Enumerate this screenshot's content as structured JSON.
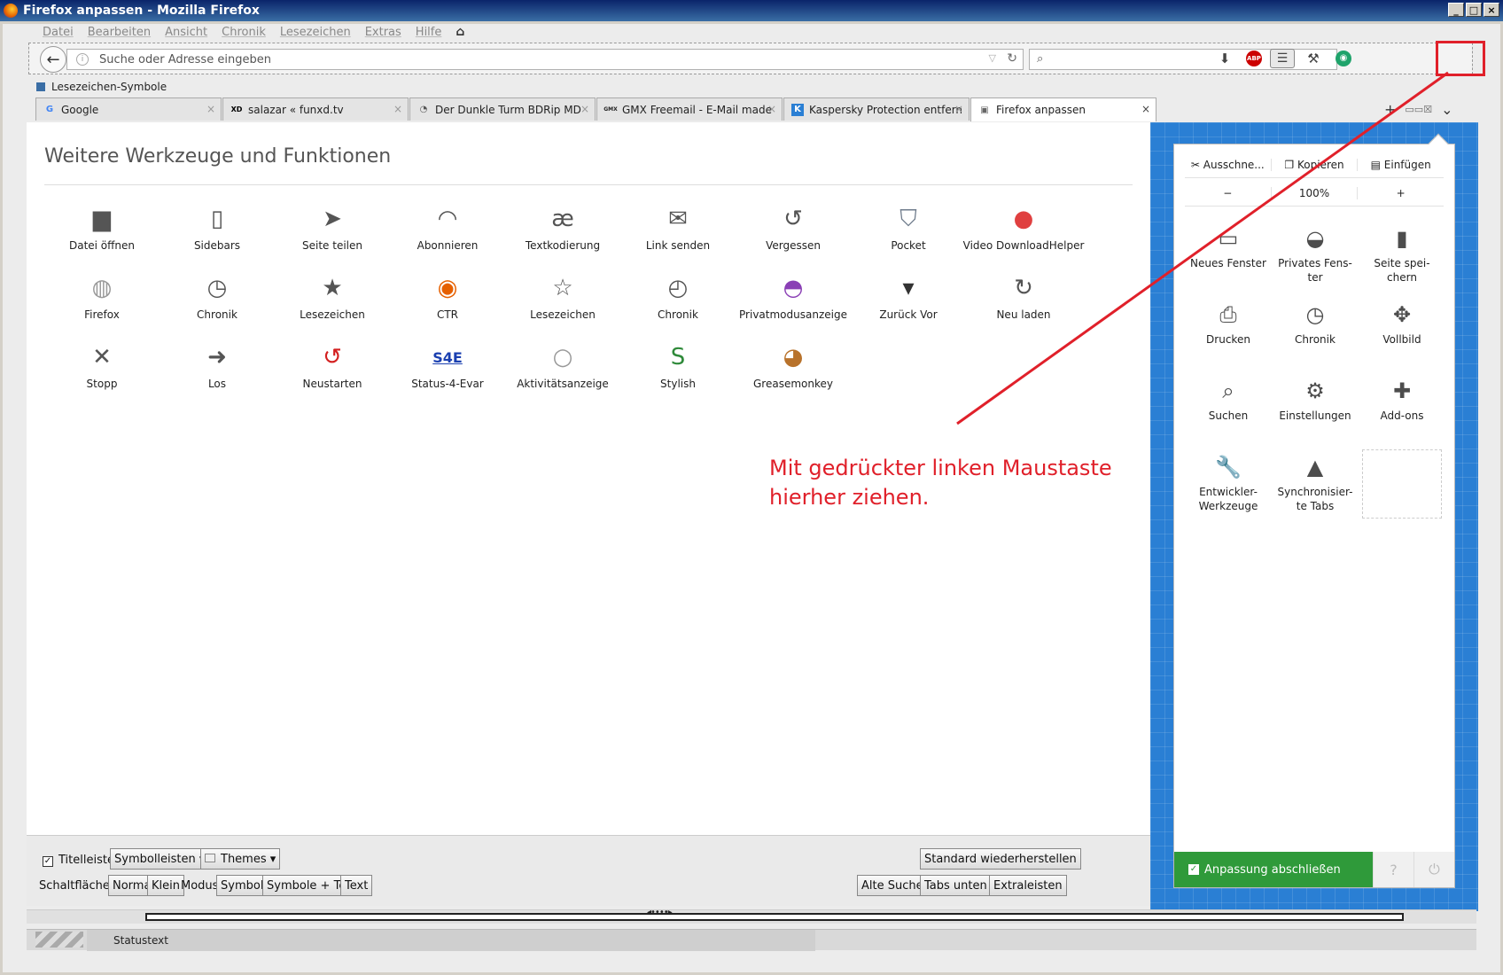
{
  "window": {
    "title": "Firefox anpassen - Mozilla Firefox",
    "controls": [
      "_",
      "□",
      "×"
    ]
  },
  "menu": [
    "Datei",
    "Bearbeiten",
    "Ansicht",
    "Chronik",
    "Lesezeichen",
    "Extras",
    "Hilfe"
  ],
  "urlbar": {
    "placeholder": "Suche oder Adresse eingeben"
  },
  "bookmarks": {
    "label": "Lesezeichen-Symbole"
  },
  "tabs": [
    {
      "title": "Google",
      "icon": "G"
    },
    {
      "title": "salazar « funxd.tv",
      "icon": "XD"
    },
    {
      "title": "Der Dunkle Turm BDRip MD",
      "icon": "◔"
    },
    {
      "title": "GMX Freemail - E-Mail made",
      "icon": "GMX"
    },
    {
      "title": "Kaspersky Protection entfern",
      "icon": "K"
    },
    {
      "title": "Firefox anpassen",
      "icon": "▣"
    }
  ],
  "main": {
    "heading": "Weitere Werkzeuge und Funktionen",
    "items": [
      {
        "label": "Datei öffnen",
        "icon": "folder-icon",
        "glyph": "▆",
        "color": "#555555"
      },
      {
        "label": "Sidebars",
        "icon": "sidebar-icon",
        "glyph": "▯",
        "color": "#555555"
      },
      {
        "label": "Seite teilen",
        "icon": "share-icon",
        "glyph": "➤",
        "color": "#555555"
      },
      {
        "label": "Abonnieren",
        "icon": "rss-icon",
        "glyph": "◠",
        "color": "#555555"
      },
      {
        "label": "Textkodierung",
        "icon": "encoding-icon",
        "glyph": "æ",
        "color": "#555555"
      },
      {
        "label": "Link senden",
        "icon": "mail-icon",
        "glyph": "✉",
        "color": "#555555"
      },
      {
        "label": "Vergessen",
        "icon": "forget-icon",
        "glyph": "↺",
        "color": "#555555"
      },
      {
        "label": "Pocket",
        "icon": "pocket-icon",
        "glyph": "⛉",
        "color": "#6f7c8c"
      },
      {
        "label": "Video DownloadHelper",
        "icon": "video-downloadhelper-icon",
        "glyph": "●",
        "color": "#e04040"
      },
      {
        "label": "Firefox",
        "icon": "firefox-gray-icon",
        "glyph": "◍",
        "color": "#999999"
      },
      {
        "label": "Chronik",
        "icon": "history-icon",
        "glyph": "◷",
        "color": "#555555"
      },
      {
        "label": "Lesezeichen",
        "icon": "bookmark-star-icon",
        "glyph": "★",
        "color": "#555555"
      },
      {
        "label": "CTR",
        "icon": "firefox-logo-icon",
        "glyph": "◉",
        "color": "#e66000"
      },
      {
        "label": "Lesezeichen",
        "icon": "bookmarks-list-icon",
        "glyph": "☆",
        "color": "#555555"
      },
      {
        "label": "Chronik",
        "icon": "history-list-icon",
        "glyph": "◴",
        "color": "#555555"
      },
      {
        "label": "Privatmodusanzeige",
        "icon": "private-mask-icon",
        "glyph": "◓",
        "color": "#8a3fb5"
      },
      {
        "label": "Zurück Vor",
        "icon": "dropdown-arrow-icon",
        "glyph": "▾",
        "color": "#333333"
      },
      {
        "label": "Neu laden",
        "icon": "reload-icon",
        "glyph": "↻",
        "color": "#555555"
      },
      {
        "label": "Stopp",
        "icon": "stop-icon",
        "glyph": "✕",
        "color": "#555555"
      },
      {
        "label": "Los",
        "icon": "go-arrow-icon",
        "glyph": "➜",
        "color": "#555555"
      },
      {
        "label": "Neustarten",
        "icon": "restart-icon",
        "glyph": "↺",
        "color": "#d32020"
      },
      {
        "label": "Status-4-Evar",
        "icon": "status4evar-icon",
        "glyph": "S4E",
        "color": "#1a3fb0"
      },
      {
        "label": "Aktivitätsanzeige",
        "icon": "activity-icon",
        "glyph": "○",
        "color": "#999999"
      },
      {
        "label": "Stylish",
        "icon": "stylish-icon",
        "glyph": "S",
        "color": "#2f8a3a"
      },
      {
        "label": "Greasemonkey",
        "icon": "greasemonkey-icon",
        "glyph": "◕",
        "color": "#b8722b"
      }
    ]
  },
  "annotation": {
    "line1": "Mit gedrückter linken Maustaste",
    "line2": "hierher ziehen."
  },
  "bottom": {
    "titlebar": "Titelleiste",
    "toolbars": "Symbolleisten ▾",
    "themes": "Themes ▾",
    "restore": "Standard wiederherstellen",
    "buttons_label": "Schaltflächen",
    "normal": "Normal",
    "small": "Klein",
    "mode_label": "Modus",
    "symbols": "Symbole",
    "symbols_text": "Symbole + Text",
    "text": "Text",
    "old_search": "Alte Suche",
    "tabs_bottom": "Tabs unten",
    "extra_bars": "Extraleisten"
  },
  "panel": {
    "cut": "Ausschne...",
    "copy": "Kopieren",
    "paste": "Einfügen",
    "zoom_out": "−",
    "zoom": "100%",
    "zoom_in": "+",
    "items": [
      {
        "label": "Neues Fenster",
        "icon": "new-window-icon",
        "glyph": "▭"
      },
      {
        "label": "Privates Fens-\nter",
        "icon": "private-window-icon",
        "glyph": "◒"
      },
      {
        "label": "Seite spei-\nchern",
        "icon": "save-page-icon",
        "glyph": "▮"
      },
      {
        "label": "Drucken",
        "icon": "print-icon",
        "glyph": "⎙"
      },
      {
        "label": "Chronik",
        "icon": "history-clock-icon",
        "glyph": "◷"
      },
      {
        "label": "Vollbild",
        "icon": "fullscreen-icon",
        "glyph": "✥"
      },
      {
        "label": "Suchen",
        "icon": "search-icon",
        "glyph": "⌕"
      },
      {
        "label": "Einstellungen",
        "icon": "gear-icon",
        "glyph": "⚙"
      },
      {
        "label": "Add-ons",
        "icon": "puzzle-icon",
        "glyph": "✚"
      },
      {
        "label": "Entwickler-\nWerkzeuge",
        "icon": "wrench-icon",
        "glyph": "🔧"
      },
      {
        "label": "Synchronisier-\nte Tabs",
        "icon": "synced-tabs-icon",
        "glyph": "▲"
      }
    ],
    "done": "Anpassung abschließen"
  },
  "status": {
    "text": "Statustext"
  },
  "colors": {
    "accent_red": "#e0202a",
    "panel_blue": "#2a7fd4",
    "done_green": "#2f9a3a"
  }
}
